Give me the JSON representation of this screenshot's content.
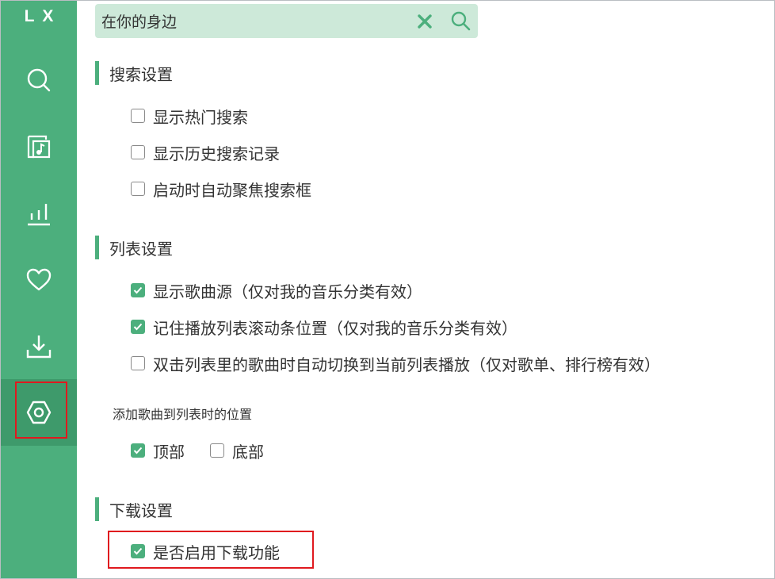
{
  "app": {
    "logo": "LX"
  },
  "sidebar": {
    "items": [
      {
        "id": "search",
        "icon": "search-icon"
      },
      {
        "id": "songlist",
        "icon": "music-list-icon"
      },
      {
        "id": "leaderboard",
        "icon": "chart-icon"
      },
      {
        "id": "favorites",
        "icon": "heart-icon"
      },
      {
        "id": "download",
        "icon": "download-icon"
      },
      {
        "id": "settings",
        "icon": "settings-icon",
        "active": true
      }
    ]
  },
  "search": {
    "value": "在你的身边",
    "clear_icon": "close-icon",
    "submit_icon": "search-icon"
  },
  "sections": {
    "search": {
      "title": "搜索设置",
      "options": [
        {
          "label": "显示热门搜索",
          "checked": false
        },
        {
          "label": "显示历史搜索记录",
          "checked": false
        },
        {
          "label": "启动时自动聚焦搜索框",
          "checked": false
        }
      ]
    },
    "list": {
      "title": "列表设置",
      "options": [
        {
          "label": "显示歌曲源（仅对我的音乐分类有效）",
          "checked": true
        },
        {
          "label": "记住播放列表滚动条位置（仅对我的音乐分类有效）",
          "checked": true
        },
        {
          "label": "双击列表里的歌曲时自动切换到当前列表播放（仅对歌单、排行榜有效）",
          "checked": false
        }
      ],
      "add_position": {
        "label": "添加歌曲到列表时的位置",
        "options": [
          {
            "label": "顶部",
            "checked": true
          },
          {
            "label": "底部",
            "checked": false
          }
        ]
      }
    },
    "download": {
      "title": "下载设置",
      "options": [
        {
          "label": "是否启用下载功能",
          "checked": true
        }
      ]
    }
  },
  "colors": {
    "accent": "#4caf7d",
    "accent_dark": "#3e9a6b",
    "highlight": "#e0191e",
    "search_bg": "#cde9d9"
  }
}
